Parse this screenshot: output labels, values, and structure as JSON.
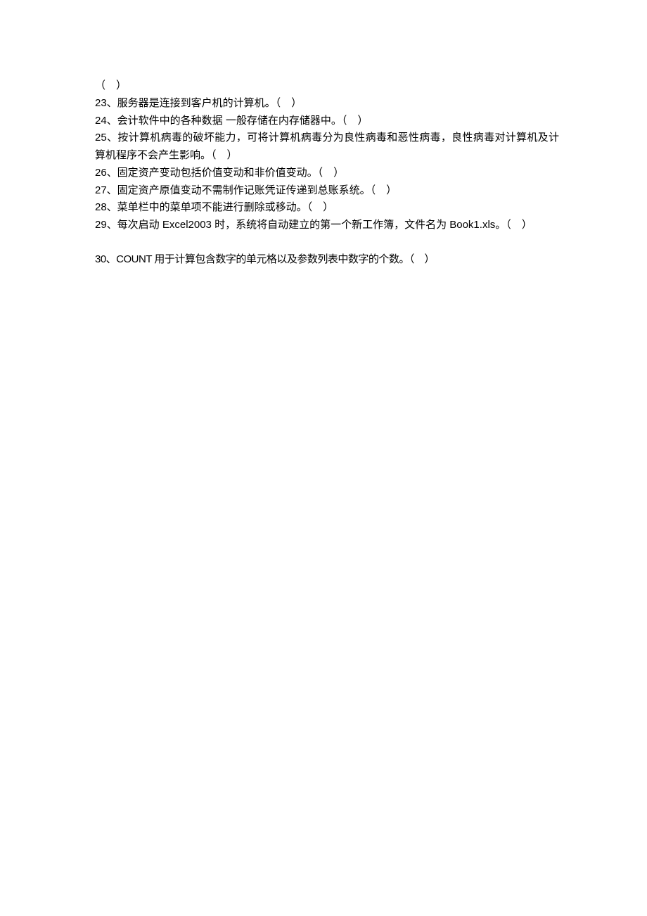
{
  "questions": {
    "q22_blank": "（　）",
    "q23": "23、服务器是连接到客户机的计算机。（　）",
    "q24": "24、会计软件中的各种数据 一般存储在内存储器中。（　）",
    "q25": "25、按计算机病毒的破坏能力，可将计算机病毒分为良性病毒和恶性病毒，良性病毒对计算机及计算机程序不会产生影响。（　）",
    "q26": "26、固定资产变动包括价值变动和非价值变动。（　）",
    "q27": "27、固定资产原值变动不需制作记账凭证传递到总账系统。（　）",
    "q28": "28、菜单栏中的菜单项不能进行删除或移动。（　）",
    "q29": "29、每次启动 Excel2003 时，系统将自动建立的第一个新工作簿，文件名为 Book1.xls。（　）",
    "q30": "30、COUNT 用于计算包含数字的单元格以及参数列表中数字的个数。（　）"
  }
}
